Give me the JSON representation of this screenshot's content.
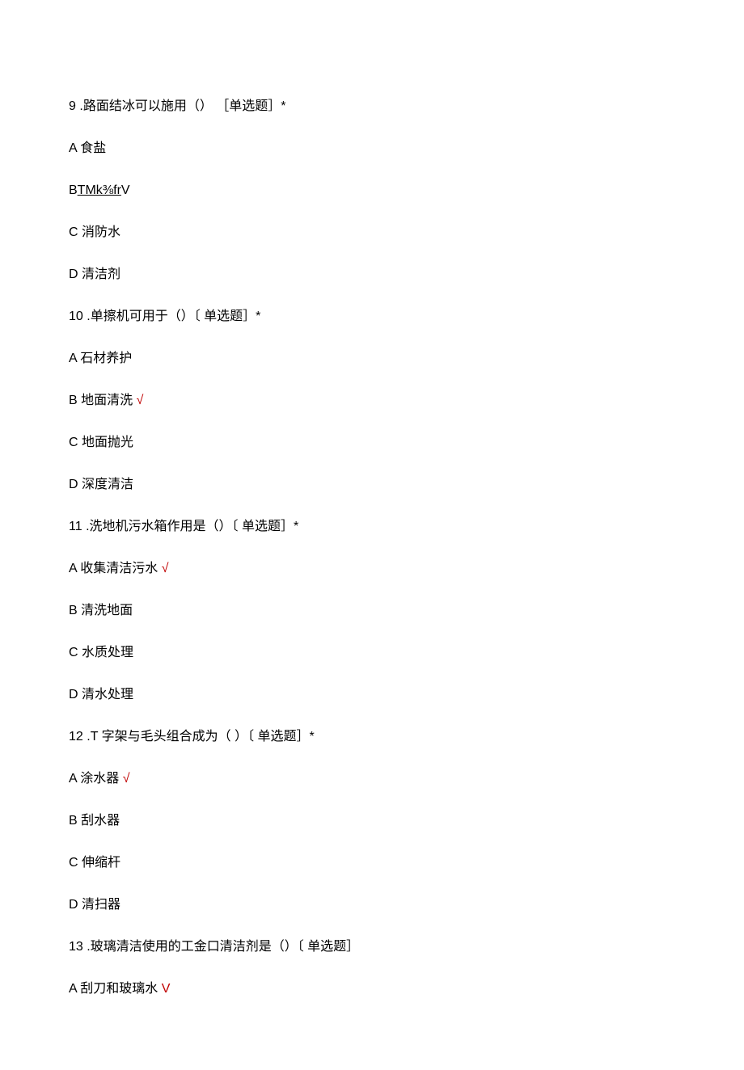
{
  "questions": [
    {
      "number": "9",
      "stem": "路面结冰可以施用（） ［单选题］*",
      "options": [
        {
          "label": "A",
          "text": "食盐",
          "underline": false,
          "correct": false,
          "mark": ""
        },
        {
          "label": "B",
          "text": "TMk⅜fr",
          "underline": true,
          "correct": true,
          "mark": "V"
        },
        {
          "label": "C",
          "text": "消防水",
          "underline": false,
          "correct": false,
          "mark": ""
        },
        {
          "label": "D",
          "text": "清洁剂",
          "underline": false,
          "correct": false,
          "mark": ""
        }
      ]
    },
    {
      "number": "10",
      "stem": "单擦机可用于（）〔 单选题］*",
      "options": [
        {
          "label": "A",
          "text": "石材养护",
          "underline": false,
          "correct": false,
          "mark": ""
        },
        {
          "label": "B",
          "text": "地面清洗",
          "underline": false,
          "correct": true,
          "mark": "√"
        },
        {
          "label": "C",
          "text": "地面抛光",
          "underline": false,
          "correct": false,
          "mark": ""
        },
        {
          "label": "D",
          "text": "深度清洁",
          "underline": false,
          "correct": false,
          "mark": ""
        }
      ]
    },
    {
      "number": "11",
      "stem": "洗地机污水箱作用是（）〔 单选题］*",
      "options": [
        {
          "label": "A",
          "text": "收集清洁污水",
          "underline": false,
          "correct": true,
          "mark": "√"
        },
        {
          "label": "B",
          "text": "清洗地面",
          "underline": false,
          "correct": false,
          "mark": ""
        },
        {
          "label": "C",
          "text": "水质处理",
          "underline": false,
          "correct": false,
          "mark": ""
        },
        {
          "label": "D",
          "text": "清水处理",
          "underline": false,
          "correct": false,
          "mark": ""
        }
      ]
    },
    {
      "number": "12",
      "stem": "T 字架与毛头组合成为（ ）〔 单选题］*",
      "options": [
        {
          "label": "A",
          "text": "涂水器",
          "underline": false,
          "correct": true,
          "mark": "√"
        },
        {
          "label": "B",
          "text": "刮水器",
          "underline": false,
          "correct": false,
          "mark": ""
        },
        {
          "label": "C",
          "text": "伸缩杆",
          "underline": false,
          "correct": false,
          "mark": ""
        },
        {
          "label": "D",
          "text": "清扫器",
          "underline": false,
          "correct": false,
          "mark": ""
        }
      ]
    },
    {
      "number": "13",
      "stem": "玻璃清洁使用的工金口清洁剂是（）〔 单选题］",
      "options": [
        {
          "label": "A",
          "text": "刮刀和玻璃水",
          "underline": false,
          "correct": true,
          "mark": "V"
        }
      ]
    }
  ]
}
